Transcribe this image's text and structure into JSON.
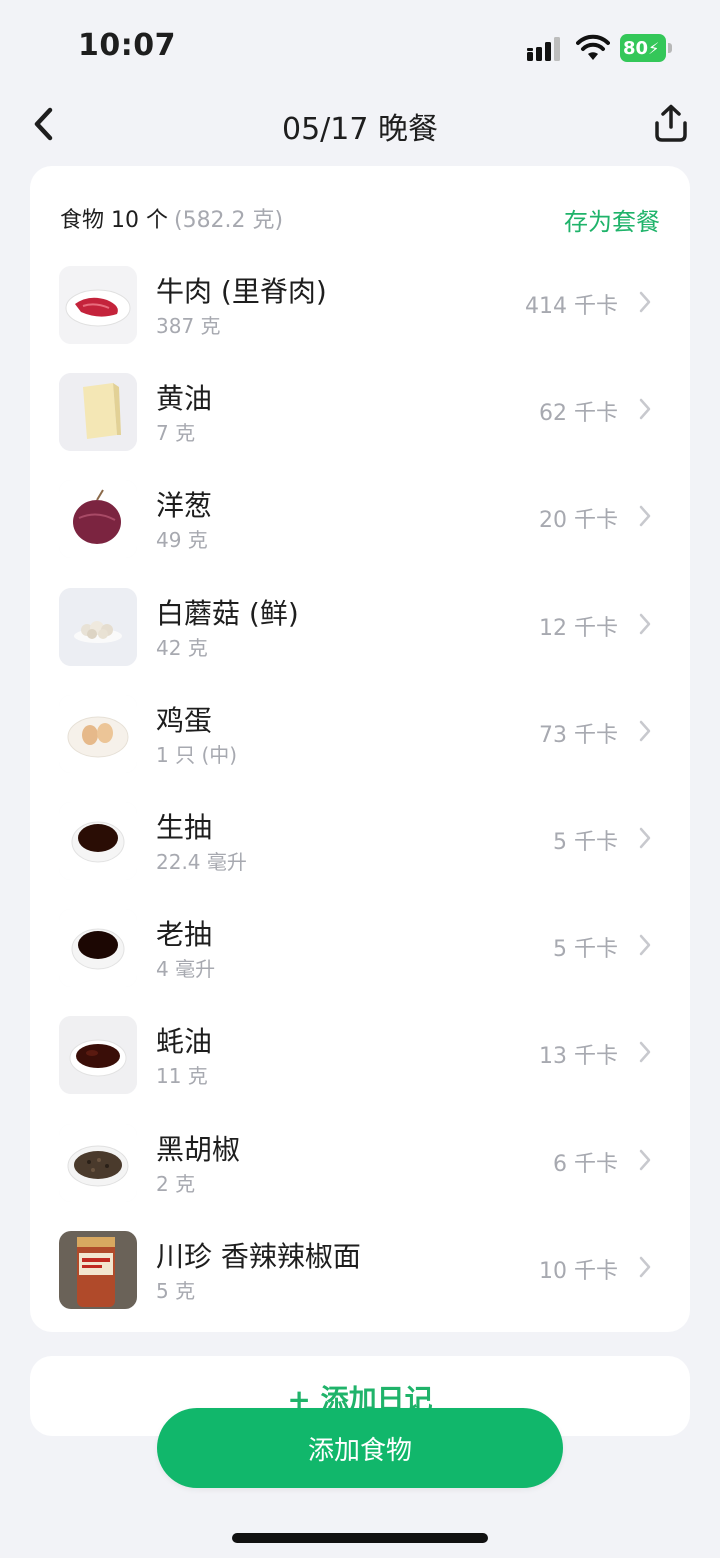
{
  "status_bar": {
    "time": "10:07",
    "battery": "80"
  },
  "nav": {
    "title": "05/17 晚餐"
  },
  "card": {
    "count_label": "食物 10 个",
    "total_weight": "(582.2 克)",
    "save_combo_label": "存为套餐"
  },
  "foods": [
    {
      "name": "牛肉 (里脊肉)",
      "amount": "387 克",
      "kcal": "414 千卡"
    },
    {
      "name": "黄油",
      "amount": "7 克",
      "kcal": "62 千卡"
    },
    {
      "name": "洋葱",
      "amount": "49 克",
      "kcal": "20 千卡"
    },
    {
      "name": "白蘑菇 (鲜)",
      "amount": "42 克",
      "kcal": "12 千卡"
    },
    {
      "name": "鸡蛋",
      "amount": "1 只 (中)",
      "kcal": "73 千卡"
    },
    {
      "name": "生抽",
      "amount": "22.4 毫升",
      "kcal": "5 千卡"
    },
    {
      "name": "老抽",
      "amount": "4 毫升",
      "kcal": "5 千卡"
    },
    {
      "name": "蚝油",
      "amount": "11 克",
      "kcal": "13 千卡"
    },
    {
      "name": "黑胡椒",
      "amount": "2 克",
      "kcal": "6 千卡"
    },
    {
      "name": "川珍 香辣辣椒面",
      "amount": "5 克",
      "kcal": "10 千卡"
    }
  ],
  "diary": {
    "label": "+ 添加日记"
  },
  "add_food": {
    "label": "添加食物"
  },
  "colors": {
    "accent": "#11b76b",
    "link_green": "#1fb36a",
    "muted": "#a7a9b0",
    "background": "#f2f3f7"
  }
}
